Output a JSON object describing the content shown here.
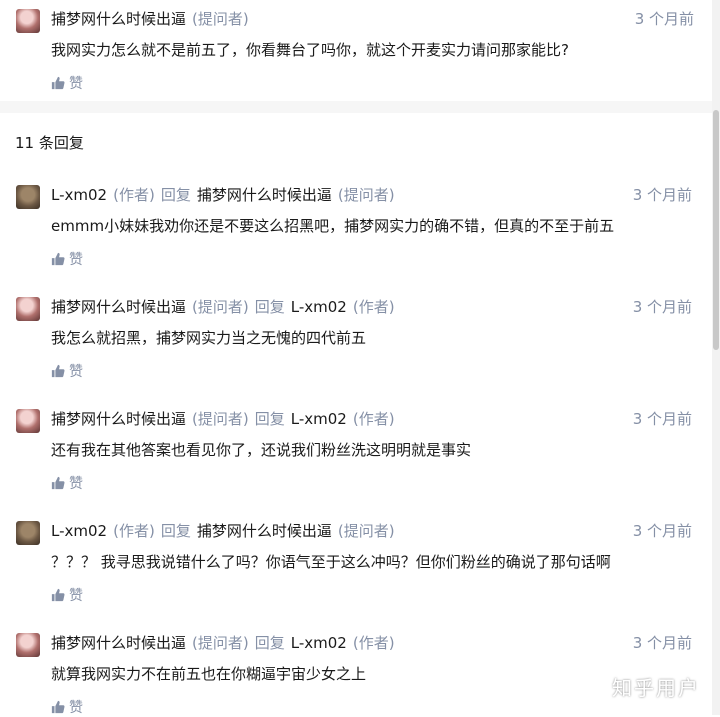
{
  "top_comment": {
    "author": "捕梦网什么时候出逼",
    "role": "(提问者)",
    "time": "3 个月前",
    "text": "我网实力怎么就不是前五了，你看舞台了吗你，就这个开麦实力请问那家能比?",
    "like_label": "赞"
  },
  "reply_count": "11 条回复",
  "replies": [
    {
      "author": "L-xm02",
      "role": "(作者)",
      "reply_word": "回复",
      "target": "捕梦网什么时候出逼",
      "target_role": "(提问者)",
      "time": "3 个月前",
      "text": "emmm小妹妹我劝你还是不要这么招黑吧，捕梦网实力的确不错，但真的不至于前五",
      "like_label": "赞"
    },
    {
      "author": "捕梦网什么时候出逼",
      "role": "(提问者)",
      "reply_word": "回复",
      "target": "L-xm02",
      "target_role": "(作者)",
      "time": "3 个月前",
      "text": "我怎么就招黑，捕梦网实力当之无愧的四代前五",
      "like_label": "赞"
    },
    {
      "author": "捕梦网什么时候出逼",
      "role": "(提问者)",
      "reply_word": "回复",
      "target": "L-xm02",
      "target_role": "(作者)",
      "time": "3 个月前",
      "text": "还有我在其他答案也看见你了，还说我们粉丝洗这明明就是事实",
      "like_label": "赞"
    },
    {
      "author": "L-xm02",
      "role": "(作者)",
      "reply_word": "回复",
      "target": "捕梦网什么时候出逼",
      "target_role": "(提问者)",
      "time": "3 个月前",
      "text": "？？？ 我寻思我说错什么了吗？你语气至于这么冲吗？但你们粉丝的确说了那句话啊",
      "like_label": "赞"
    },
    {
      "author": "捕梦网什么时候出逼",
      "role": "(提问者)",
      "reply_word": "回复",
      "target": "L-xm02",
      "target_role": "(作者)",
      "time": "3 个月前",
      "text": "就算我网实力不在前五也在你糊逼宇宙少女之上",
      "like_label": "赞"
    }
  ],
  "watermark": "知乎用户"
}
